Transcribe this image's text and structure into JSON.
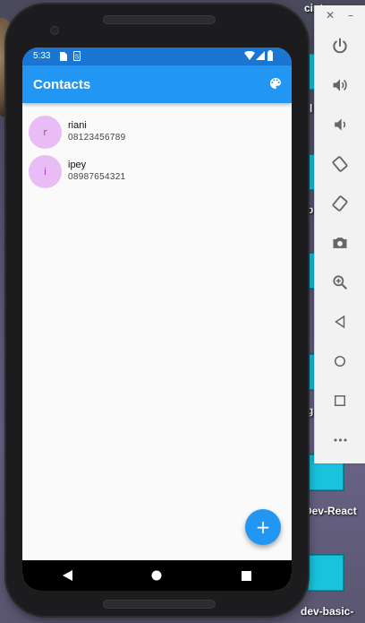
{
  "statusbar": {
    "time": "5:33"
  },
  "appbar": {
    "title": "Contacts",
    "theme_icon": "palette-icon"
  },
  "contacts": [
    {
      "initial": "r",
      "name": "riani",
      "phone": "08123456789"
    },
    {
      "initial": "i",
      "name": "ipey",
      "phone": "08987654321"
    }
  ],
  "fab": {
    "label": "+"
  },
  "navbar": {
    "icons": [
      "back-icon",
      "home-icon",
      "recents-icon"
    ]
  },
  "emulator_panel": {
    "close_label": "✕",
    "minimize_label": "–",
    "tools": [
      "power-icon",
      "volume-up-icon",
      "volume-down-icon",
      "rotate-left-icon",
      "rotate-right-icon",
      "camera-icon",
      "zoom-icon",
      "back-icon",
      "home-icon",
      "overview-icon",
      "more-icon"
    ],
    "more_label": "•••"
  },
  "desktop": {
    "labels": [
      "cint",
      "l",
      "b",
      "g",
      "Dev-React",
      "dev-basic-"
    ]
  },
  "colors": {
    "primary": "#2196f3",
    "status_bar": "#1976d2",
    "avatar_bg": "#e9bcf5",
    "avatar_text": "#b03ac6"
  }
}
